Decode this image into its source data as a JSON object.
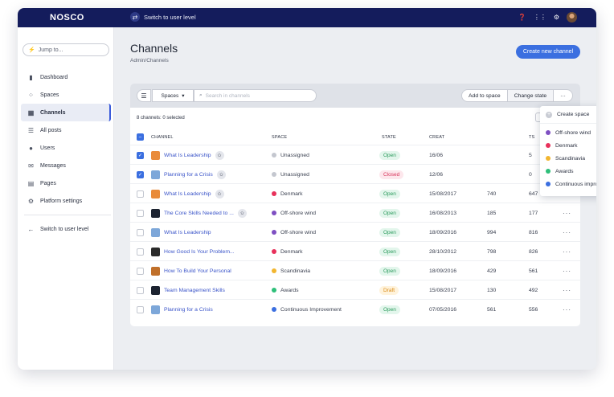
{
  "topbar": {
    "logo": "NOSCO",
    "switch_label": "Switch to user level"
  },
  "sidebar": {
    "jump_placeholder": "Jump to...",
    "items": [
      {
        "label": "Dashboard",
        "icon": "bar-chart-icon"
      },
      {
        "label": "Spaces",
        "icon": "spaces-icon"
      },
      {
        "label": "Channels",
        "icon": "channels-icon"
      },
      {
        "label": "All posts",
        "icon": "posts-icon"
      },
      {
        "label": "Users",
        "icon": "user-icon"
      },
      {
        "label": "Messages",
        "icon": "mail-icon"
      },
      {
        "label": "Pages",
        "icon": "page-icon"
      },
      {
        "label": "Platform settings",
        "icon": "gear-icon"
      }
    ],
    "switch_label": "Switch to user level"
  },
  "main": {
    "title": "Channels",
    "breadcrumb": "Admin/Channels",
    "create_button": "Create new channel"
  },
  "toolbar": {
    "spaces_filter": "Spaces",
    "search_placeholder": "Search in channels",
    "add_to_space": "Add to space",
    "change_state": "Change state",
    "more": "···"
  },
  "table": {
    "count_text": "8 channels: 0 selected",
    "headers": {
      "channel": "CHANNEL",
      "space": "SPACE",
      "state": "STATE",
      "created": "CREAT",
      "posts": "TS"
    },
    "rows": [
      {
        "name": "What Is Leadership",
        "space": "Unassigned",
        "space_color": "#c4c7cf",
        "state": "Open",
        "created": "16/06",
        "members": "",
        "posts": "5",
        "checked": true,
        "pin": true,
        "thumb": "#e98b3a"
      },
      {
        "name": "Planning for a Crisis",
        "space": "Unassigned",
        "space_color": "#c4c7cf",
        "state": "Closed",
        "created": "12/06",
        "members": "",
        "posts": "0",
        "checked": true,
        "pin": true,
        "thumb": "#7da7d9"
      },
      {
        "name": "What Is Leadership",
        "space": "Denmark",
        "space_color": "#e8315b",
        "state": "Open",
        "created": "15/08/2017",
        "members": "740",
        "posts": "647",
        "checked": false,
        "pin": true,
        "thumb": "#e98b3a"
      },
      {
        "name": "The Core Skills Needed to ...",
        "space": "Off-shore wind",
        "space_color": "#7e4fc2",
        "state": "Open",
        "created": "16/08/2013",
        "members": "185",
        "posts": "177",
        "checked": false,
        "pin": true,
        "thumb": "#1c2330"
      },
      {
        "name": "What Is Leadership",
        "space": "Off-shore wind",
        "space_color": "#7e4fc2",
        "state": "Open",
        "created": "18/09/2016",
        "members": "994",
        "posts": "816",
        "checked": false,
        "pin": false,
        "thumb": "#7da7d9"
      },
      {
        "name": "How Good Is Your Problem...",
        "space": "Denmark",
        "space_color": "#e8315b",
        "state": "Open",
        "created": "28/10/2012",
        "members": "798",
        "posts": "826",
        "checked": false,
        "pin": false,
        "thumb": "#2a2a2a"
      },
      {
        "name": "How To Build Your Personal",
        "space": "Scandinavia",
        "space_color": "#f2b630",
        "state": "Open",
        "created": "18/09/2016",
        "members": "429",
        "posts": "561",
        "checked": false,
        "pin": false,
        "thumb": "#c0702a"
      },
      {
        "name": "Team Management Skills",
        "space": "Awards",
        "space_color": "#2fbf7a",
        "state": "Draft",
        "created": "15/08/2017",
        "members": "130",
        "posts": "492",
        "checked": false,
        "pin": false,
        "thumb": "#1c2330"
      },
      {
        "name": "Planning for a Crisis",
        "space": "Continuous Improvement",
        "space_color": "#3b6fe0",
        "state": "Open",
        "created": "07/05/2016",
        "members": "561",
        "posts": "556",
        "checked": false,
        "pin": false,
        "thumb": "#7da7d9"
      }
    ]
  },
  "state_colors": {
    "Open": {
      "bg": "#e3f6ec",
      "fg": "#2b9a5c"
    },
    "Closed": {
      "bg": "#fde7ec",
      "fg": "#d6345a"
    },
    "Draft": {
      "bg": "#fff3dc",
      "fg": "#d98a14"
    }
  },
  "dropdown": {
    "create_space": "Create space",
    "items": [
      {
        "label": "Off-shore wind",
        "color": "#7e4fc2"
      },
      {
        "label": "Denmark",
        "color": "#e8315b"
      },
      {
        "label": "Scandinavia",
        "color": "#f2b630"
      },
      {
        "label": "Awards",
        "color": "#2fbf7a"
      },
      {
        "label": "Continuous improvement",
        "color": "#3b6fe0"
      }
    ]
  }
}
